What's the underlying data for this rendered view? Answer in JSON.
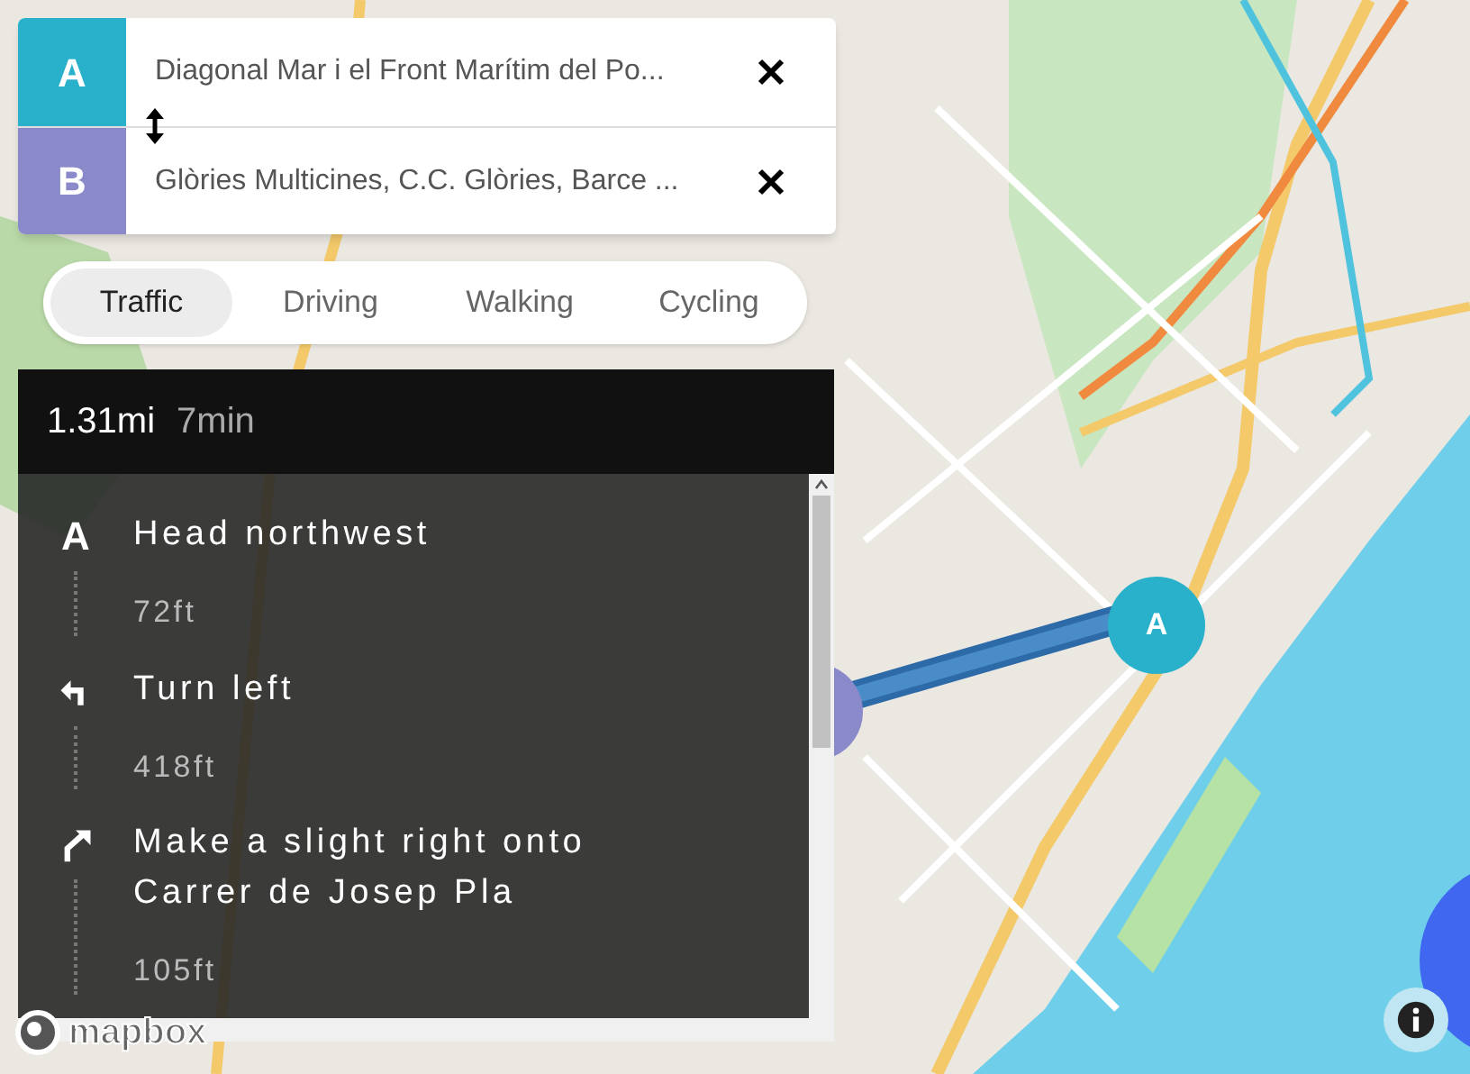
{
  "route_inputs": [
    {
      "marker": "A",
      "color": "#29b1cc",
      "value": "Diagonal Mar i el Front Marítim del Po..."
    },
    {
      "marker": "B",
      "color": "#8a8acb",
      "value": "Glòries Multicines, C.C. Glòries, Barce ..."
    }
  ],
  "profiles": [
    {
      "label": "Traffic",
      "selected": true
    },
    {
      "label": "Driving",
      "selected": false
    },
    {
      "label": "Walking",
      "selected": false
    },
    {
      "label": "Cycling",
      "selected": false
    }
  ],
  "summary": {
    "distance": "1.31mi",
    "duration": "7min"
  },
  "steps": [
    {
      "kind": "depart",
      "marker": "A",
      "instruction": "Head northwest",
      "distance": "72ft"
    },
    {
      "kind": "left",
      "instruction": "Turn left",
      "distance": "418ft"
    },
    {
      "kind": "slight-right",
      "instruction": "Make a slight right onto Carrer de Josep Pla",
      "distance": "105ft"
    }
  ],
  "map": {
    "origin_marker": "A",
    "attribution_logo": "mapbox"
  }
}
